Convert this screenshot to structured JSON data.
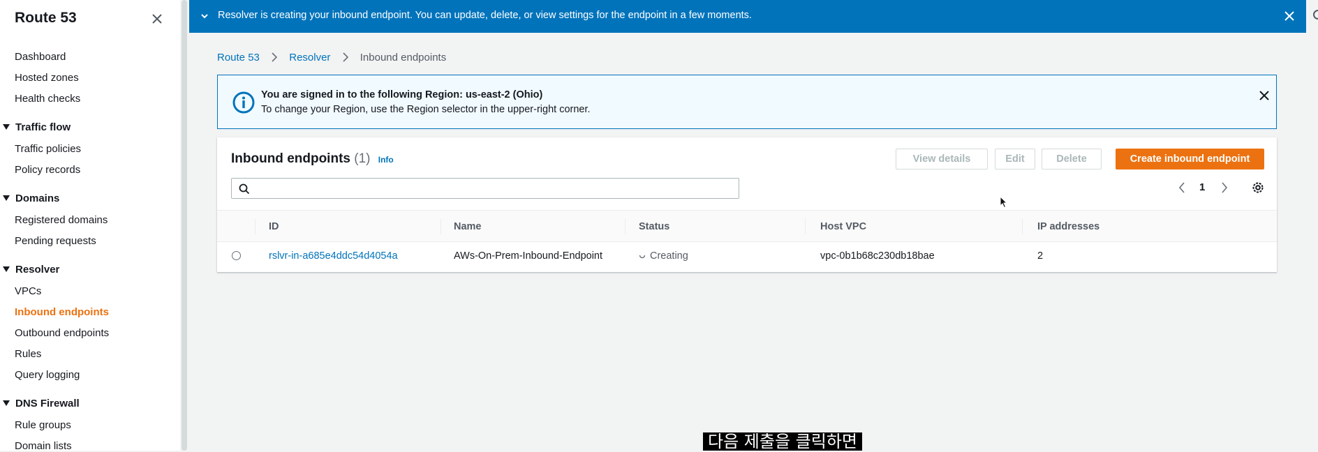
{
  "sidebar": {
    "title": "Route 53",
    "items": {
      "dashboard": "Dashboard",
      "hosted_zones": "Hosted zones",
      "health_checks": "Health checks",
      "traffic_policies": "Traffic policies",
      "policy_records": "Policy records",
      "registered_domains": "Registered domains",
      "pending_requests": "Pending requests",
      "vpcs": "VPCs",
      "inbound_endpoints": "Inbound endpoints",
      "outbound_endpoints": "Outbound endpoints",
      "rules": "Rules",
      "query_logging": "Query logging",
      "rule_groups": "Rule groups",
      "domain_lists": "Domain lists"
    },
    "groups": {
      "traffic_flow": "Traffic flow",
      "domains": "Domains",
      "resolver": "Resolver",
      "dns_firewall": "DNS Firewall"
    },
    "active_item": "Inbound endpoints",
    "active_color": "#ec7211"
  },
  "flash": {
    "message": "Resolver is creating your inbound endpoint. You can update, delete, or view settings for the endpoint in a few moments.",
    "color": "#0073bb"
  },
  "breadcrumb": {
    "root": "Route 53",
    "parent": "Resolver",
    "current": "Inbound endpoints"
  },
  "region_alert": {
    "title": "You are signed in to the following Region: us-east-2 (Ohio)",
    "body": "To change your Region, use the Region selector in the upper-right corner."
  },
  "panel": {
    "title": "Inbound endpoints",
    "count": "(1)",
    "info": "Info",
    "buttons": {
      "view_details": "View details",
      "edit": "Edit",
      "delete": "Delete",
      "create": "Create inbound endpoint"
    },
    "search": {
      "value": "",
      "placeholder": ""
    },
    "pagination": {
      "current_page": "1"
    },
    "columns": {
      "id": "ID",
      "name": "Name",
      "status": "Status",
      "host_vpc": "Host VPC",
      "ip_addresses": "IP addresses"
    },
    "rows": [
      {
        "id": "rslvr-in-a685e4ddc54d4054a",
        "name": "AWs-On-Prem-Inbound-Endpoint",
        "status": "Creating",
        "host_vpc": "vpc-0b1b68c230db18bae",
        "ip_addresses": "2"
      }
    ]
  },
  "caption": "다음 제출을 클릭하면",
  "colors": {
    "primary_button": "#ec7211",
    "link": "#0073bb",
    "background": "#f2f3f3"
  }
}
